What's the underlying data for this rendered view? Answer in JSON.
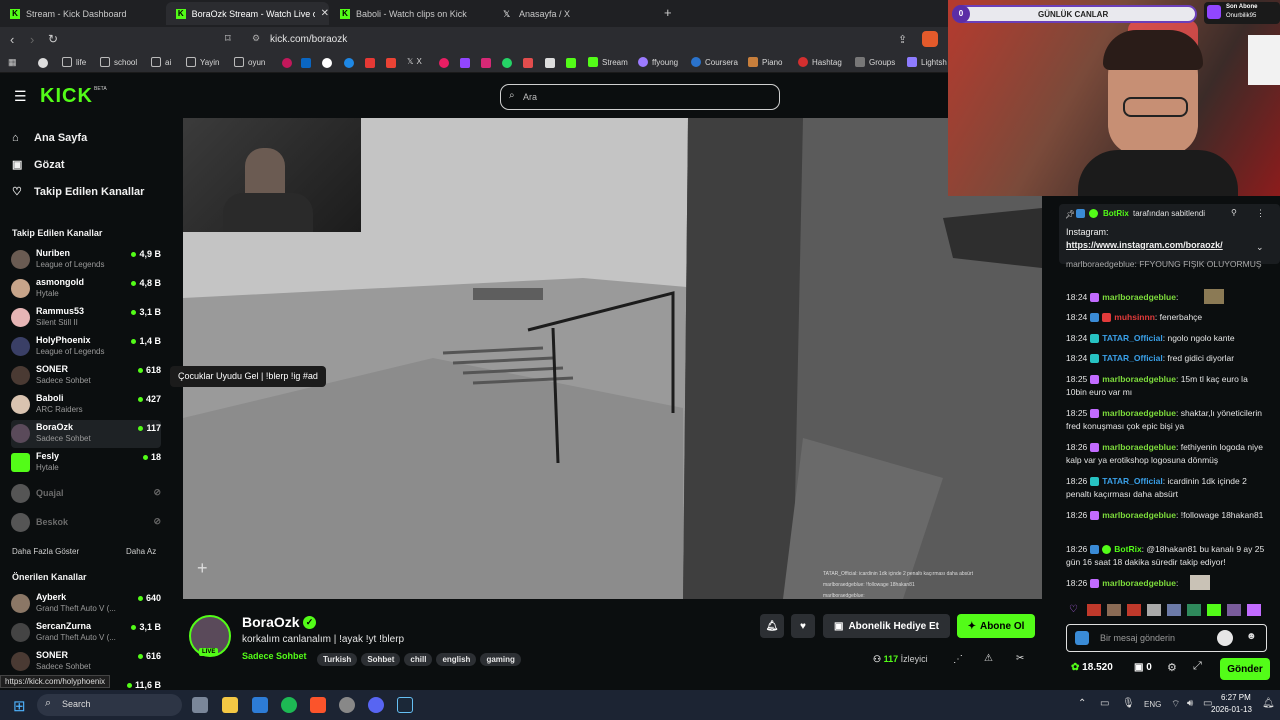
{
  "browser": {
    "tabs": [
      {
        "label": "Stream - Kick Dashboard"
      },
      {
        "label": "BoraOzk Stream - Watch Live on"
      },
      {
        "label": "Baboli - Watch clips on Kick"
      },
      {
        "label": "Anasayfa / X"
      }
    ],
    "address": "kick.com/boraozk",
    "bookmarks": [
      "life",
      "school",
      "ai",
      "Yayin",
      "oyun",
      "X",
      "Stream",
      "ffyoung",
      "Coursera",
      "Piano",
      "Hashtag",
      "Groups",
      "Lightsh"
    ]
  },
  "kick": {
    "logo": "KICK",
    "logo_badge": "BETA",
    "search_placeholder": "Ara",
    "nav": [
      {
        "label": "Ana Sayfa",
        "icon": "home-icon"
      },
      {
        "label": "Gözat",
        "icon": "browse-icon"
      },
      {
        "label": "Takip Edilen Kanallar",
        "icon": "heart-icon"
      }
    ],
    "followed_title": "Takip Edilen Kanallar",
    "followed": [
      {
        "name": "Nuriben",
        "sub": "League of Legends",
        "viewers": "4,9 B"
      },
      {
        "name": "asmongold",
        "sub": "Hytale",
        "viewers": "4,8 B"
      },
      {
        "name": "Rammus53",
        "sub": "Silent Still II",
        "viewers": "3,1 B"
      },
      {
        "name": "HolyPhoenix",
        "sub": "League of Legends",
        "viewers": "1,4 B"
      },
      {
        "name": "SONER",
        "sub": "Sadece Sohbet",
        "viewers": "618"
      },
      {
        "name": "Baboli",
        "sub": "ARC Raiders",
        "viewers": "427"
      },
      {
        "name": "BoraOzk",
        "sub": "Sadece Sohbet",
        "viewers": "117"
      },
      {
        "name": "Fesly",
        "sub": "Hytale",
        "viewers": "18"
      },
      {
        "name": "Quajal",
        "sub": "",
        "viewers": ""
      },
      {
        "name": "Beskok",
        "sub": "",
        "viewers": ""
      }
    ],
    "show_more": "Daha Fazla Göster",
    "show_less": "Daha Az",
    "recommended_title": "Önerilen Kanallar",
    "recommended": [
      {
        "name": "Ayberk",
        "sub": "Grand Theft Auto V (...",
        "viewers": "640"
      },
      {
        "name": "SercanZurna",
        "sub": "Grand Theft Auto V (...",
        "viewers": "3,1 B"
      },
      {
        "name": "SONER",
        "sub": "Sadece Sohbet",
        "viewers": "616"
      },
      {
        "name": "",
        "sub": "",
        "viewers": "11,6 B"
      }
    ],
    "status_url": "https://kick.com/holyphoenix",
    "tooltip": "Çocuklar Uyudu Gel | !blerp !ig #ad"
  },
  "stream": {
    "channel": "BoraOzk",
    "title": "korkalım canlanalım | !ayak !yt !blerp",
    "category": "Sadece Sohbet",
    "tags": [
      "Turkish",
      "Sohbet",
      "chill",
      "english",
      "gaming"
    ],
    "live_label": "LIVE",
    "viewers": "117",
    "viewers_label": "İzleyici",
    "gift_label": "Abonelik Hediye Et",
    "sub_label": "Abone Ol",
    "overlay_chat": [
      "TATAR_Official: icardinin 1dk içinde 2 penaltı kaçırması daha absürt",
      "marlboraedgeblue: !followage 18hakan81",
      "marlboraedgeblue:"
    ]
  },
  "overlay": {
    "counter": "0",
    "title": "GÜNLÜK CANLAR",
    "last_sub_label": "Son Abone",
    "last_sub_name": "Onurbilik95"
  },
  "chat": {
    "pinned_by": "BotRix",
    "pinned_suffix": "tarafından sabitlendi",
    "pinned_title": "Instagram:",
    "pinned_link": "https://www.instagram.com/boraozk/",
    "partial_top": "marlboraedgeblue: FFYOUNG FIŞIK OLUYORMUŞ",
    "messages": [
      {
        "time": "18:24",
        "user": "marlboraedgeblue",
        "color": "#7ddc3c",
        "text": ""
      },
      {
        "time": "18:24",
        "user": "muhsinnn",
        "color": "#e23b3b",
        "text": "fenerbahçe"
      },
      {
        "time": "18:24",
        "user": "TATAR_Official",
        "color": "#3aa0e8",
        "text": "ngolo ngolo kante"
      },
      {
        "time": "18:24",
        "user": "TATAR_Official",
        "color": "#3aa0e8",
        "text": "fred gidici diyorlar"
      },
      {
        "time": "18:25",
        "user": "marlboraedgeblue",
        "color": "#7ddc3c",
        "text": "15m tl kaç euro la 10bin euro var mı"
      },
      {
        "time": "18:25",
        "user": "marlboraedgeblue",
        "color": "#7ddc3c",
        "text": "shaktar,lı yöneticilerin fred konuşması çok epic bişi ya"
      },
      {
        "time": "18:26",
        "user": "marlboraedgeblue",
        "color": "#7ddc3c",
        "text": "fethiyenin logoda niye kalp var ya erotikshop logosuna dönmüş"
      },
      {
        "time": "18:26",
        "user": "TATAR_Official",
        "color": "#3aa0e8",
        "text": "icardinin 1dk içinde 2 penaltı kaçırması daha absürt"
      },
      {
        "time": "18:26",
        "user": "marlboraedgeblue",
        "color": "#7ddc3c",
        "text": "!followage 18hakan81"
      },
      {
        "time": "18:26",
        "user": "BotRix",
        "color": "#53fc18",
        "text": "@18hakan81 bu kanalı 9 ay 25 gün 16 saat 18 dakika süredir takip ediyor!"
      },
      {
        "time": "18:26",
        "user": "marlboraedgeblue",
        "color": "#7ddc3c",
        "text": ""
      }
    ],
    "input_placeholder": "Bir mesaj gönderin",
    "points": "18.520",
    "zero": "0",
    "send_label": "Gönder"
  },
  "taskbar": {
    "search_label": "Search",
    "lang": "ENG",
    "time": "6:27 PM",
    "date": "2026-01-13"
  }
}
